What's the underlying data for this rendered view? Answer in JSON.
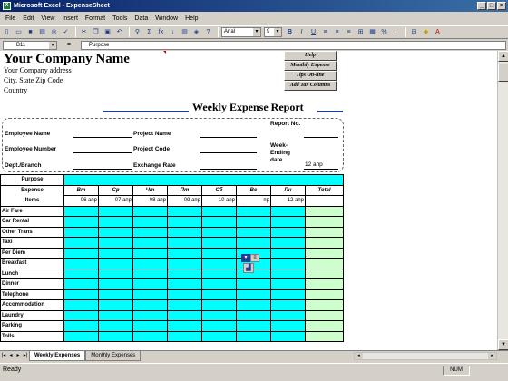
{
  "window": {
    "title": "Microsoft Excel - ExpenseSheet",
    "min": "_",
    "max": "□",
    "close": "×"
  },
  "menu": [
    "File",
    "Edit",
    "View",
    "Insert",
    "Format",
    "Tools",
    "Data",
    "Window",
    "Help"
  ],
  "toolbar": {
    "font": "Arial",
    "size": "9",
    "bold": "B",
    "italic": "I",
    "underline": "U",
    "percent": "%",
    "comma": ",",
    "sum": "Σ",
    "fx": "fx"
  },
  "formula_bar": {
    "cell": "B11",
    "content": "Purpose",
    "eq": "="
  },
  "sheet": {
    "company": "Your Company Name",
    "address": [
      "Your Company address",
      "City, State  Zip Code",
      "Country"
    ],
    "macros": [
      "Help",
      "Monthly Expense",
      "Tips On-line",
      "Add Tax Columns"
    ],
    "report_title": "Weekly Expense Report",
    "info": {
      "employee_name": "Employee Name",
      "employee_number": "Employee Number",
      "dept": "Dept./Branch",
      "project_name": "Project Name",
      "project_code": "Project Code",
      "exchange_rate": "Exchange Rate",
      "report_no": "Report No.",
      "week_ending": "Week-Ending date",
      "week_ending_value": "12 апр"
    },
    "purpose_label": "Purpose",
    "expense_label": "Expense",
    "items_label": "Items",
    "day_headers": [
      "Вт",
      "Ср",
      "Чт",
      "Пт",
      "Сб",
      "Вс",
      "Пн",
      "Total"
    ],
    "dates": [
      "06 апр",
      "07 апр",
      "08 апр",
      "09 апр",
      "10 апр",
      "",
      "12 апр"
    ],
    "date_partial": "пр",
    "items": [
      "Air Fare",
      "Car Rental",
      "Other Trans",
      "Taxi",
      "Per Diem",
      "Breakfast",
      "Lunch",
      "Dinner",
      "Telephone",
      "Accommodation",
      "Laundry",
      "Parking",
      "Tolls"
    ]
  },
  "tabs": [
    "Weekly Expenses",
    "Monthly Expenses"
  ],
  "status": {
    "ready": "Ready",
    "num": "NUM"
  },
  "colors": {
    "cyan": "#00ffff",
    "total": "#ccffcc",
    "title_rule": "#1c3f94"
  }
}
